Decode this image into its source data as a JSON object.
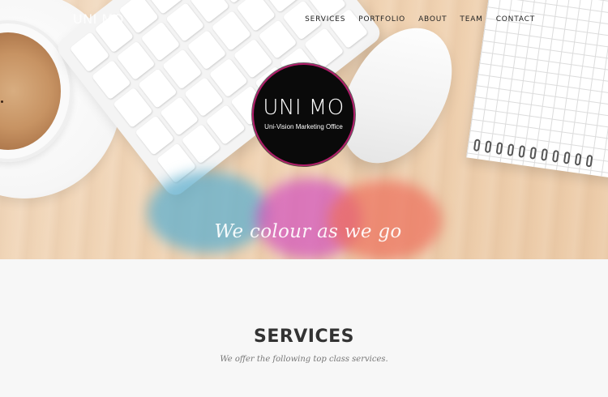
{
  "header": {
    "brand": "UNI MO",
    "nav": [
      "SERVICES",
      "PORTFOLIO",
      "ABOUT",
      "TEAM",
      "CONTACT"
    ]
  },
  "hero": {
    "logo_title": "UNI MO",
    "logo_subtitle": "Uni-Vision Marketing Office",
    "tagline": "We colour as we go"
  },
  "services": {
    "heading": "SERVICES",
    "subheading": "We offer the following top class services."
  },
  "colors": {
    "accent": "#b21c6a",
    "heading": "#333333",
    "background": "#f7f7f7"
  }
}
